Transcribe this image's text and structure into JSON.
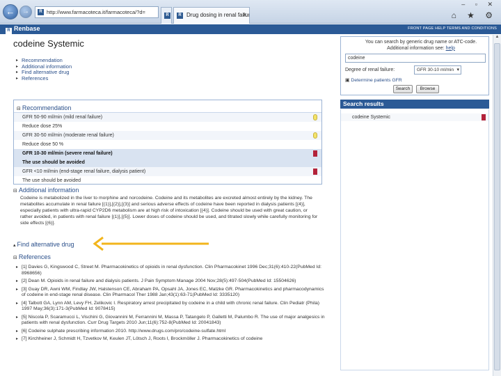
{
  "browser": {
    "address": "http://www.farmacoteca.it/farmacoteca/?d=",
    "tabs": [
      {
        "label": ""
      },
      {
        "label": "Drug dosing in renal failure"
      }
    ],
    "window_controls": "– ▫ ✕",
    "tool_icons": "⌂ ★ ⚙"
  },
  "site": {
    "brand": "Renbase",
    "header_links": "FRONT PAGE   HELP   TERMS AND CONDITIONS"
  },
  "page": {
    "title": "codeine Systemic",
    "toc": [
      "Recommendation",
      "Additional information",
      "Find alternative drug",
      "References"
    ]
  },
  "recommendation": {
    "heading": "Recommendation",
    "rows": [
      {
        "text": "GFR 50-90 ml/min (mild renal failure)",
        "severity": "yellow",
        "style": "odd"
      },
      {
        "text": "Reduce dose 25%",
        "severity": "",
        "style": ""
      },
      {
        "text": "GFR 30-50 ml/min (moderate renal failure)",
        "severity": "yellow",
        "style": "odd"
      },
      {
        "text": "Reduce dose 50 %",
        "severity": "",
        "style": ""
      },
      {
        "text": "GFR 10-30 ml/min (severe renal failure)",
        "severity": "red",
        "style": "hl"
      },
      {
        "text": "The use should be avoided",
        "severity": "",
        "style": "hl"
      },
      {
        "text": "GFR <10 ml/min (end-stage renal failure, dialysis patient)",
        "severity": "red",
        "style": "odd"
      },
      {
        "text": "The use should be avoided",
        "severity": "",
        "style": ""
      }
    ]
  },
  "additional": {
    "heading": "Additional information",
    "text": "Codeine is metabolized in the liver to morphine and norcodeine. Codeine and its metabolites are excreted almost entirely by the kidney. The metabolites accumulate in renal failure [(1)],[(2)],[(3)] and serious adverse effects of codeine have been reported in dialysis patients [(4)], especially patients with ultra-rapid CYP2D6 metabolism are at high risk of intoxication [(4)]. Codeine should be used with great caution, or rather avoided, in patients with renal failure [(1)],[(5)]. Lower doses of codeine should be used, and titrated slowly while carefully monitoring for side effects [(6)]."
  },
  "alternative": {
    "heading": "Find alternative drug"
  },
  "references": {
    "heading": "References",
    "items": [
      "[1] Davies G, Kingswood C, Street M. Pharmacokinetics of opioids in renal dysfunction. Clin Pharmacokinet 1996 Dec;31(6):410-22(PubMed Id: 8968656)",
      "[2] Dean M. Opioids in renal failure and dialysis patients. J Pain Symptom Manage 2004 Nov;28(5):497-504(PubMed Id: 15504626)",
      "[3] Guay DR, Awni WM, Findlay JW, Halstenson CE, Abraham PA, Opsahl JA, Jones EC, Matzke GR. Pharmacokinetics and pharmacodynamics of codeine in end-stage renal disease. Clin Pharmacol Ther 1988 Jan;43(1):63-71(PubMed Id: 3335120)",
      "[4] Talbott GA, Lynn AM, Levy FH, Zelikovic I. Respiratory arrest precipitated by codeine in a child with chronic renal failure. Clin Pediatr (Phila) 1997 May;36(3):171-3(PubMed Id: 9078415)",
      "[5] Niscola P, Scaramucci L, Vischini G, Giovannini M, Ferrannini M, Massa P, Tatangelo P, Galletti M, Palumbo R. The use of major analgesics in patients with renal dysfunction. Curr Drug Targets 2010 Jun;11(6):752-8(PubMed Id: 20041843)",
      "[6] Codeine sulphate prescribing information 2010. http://www.drugs.com/pro/codeine-sulfate.html",
      "[7] Kirchheiner J, Schmidt H, Tzvetkov M, Keulen JT, Lötsch J, Roots I, Brockmöller J. Pharmacokinetics of codeine"
    ]
  },
  "search": {
    "info_line1": "You can search by generic drug name or ATC-code.",
    "info_line2": "Additional information see:",
    "help_link": "help",
    "drug_value": "codeine",
    "gfr_label": "Degree of renal failure:",
    "gfr_value": "GFR 30-10 ml/min",
    "determine_link": "Determine patients GFR",
    "search_button": "Search",
    "browse_button": "Browse"
  },
  "results": {
    "heading": "Search results",
    "items": [
      {
        "label": "codeine Systemic",
        "severity": "red"
      }
    ]
  },
  "colors": {
    "brand_blue": "#2b5a96",
    "link": "#2a4f8a",
    "severity_yellow": "#f3e36a",
    "severity_red": "#b3223a",
    "arrow": "#f2b51c"
  }
}
